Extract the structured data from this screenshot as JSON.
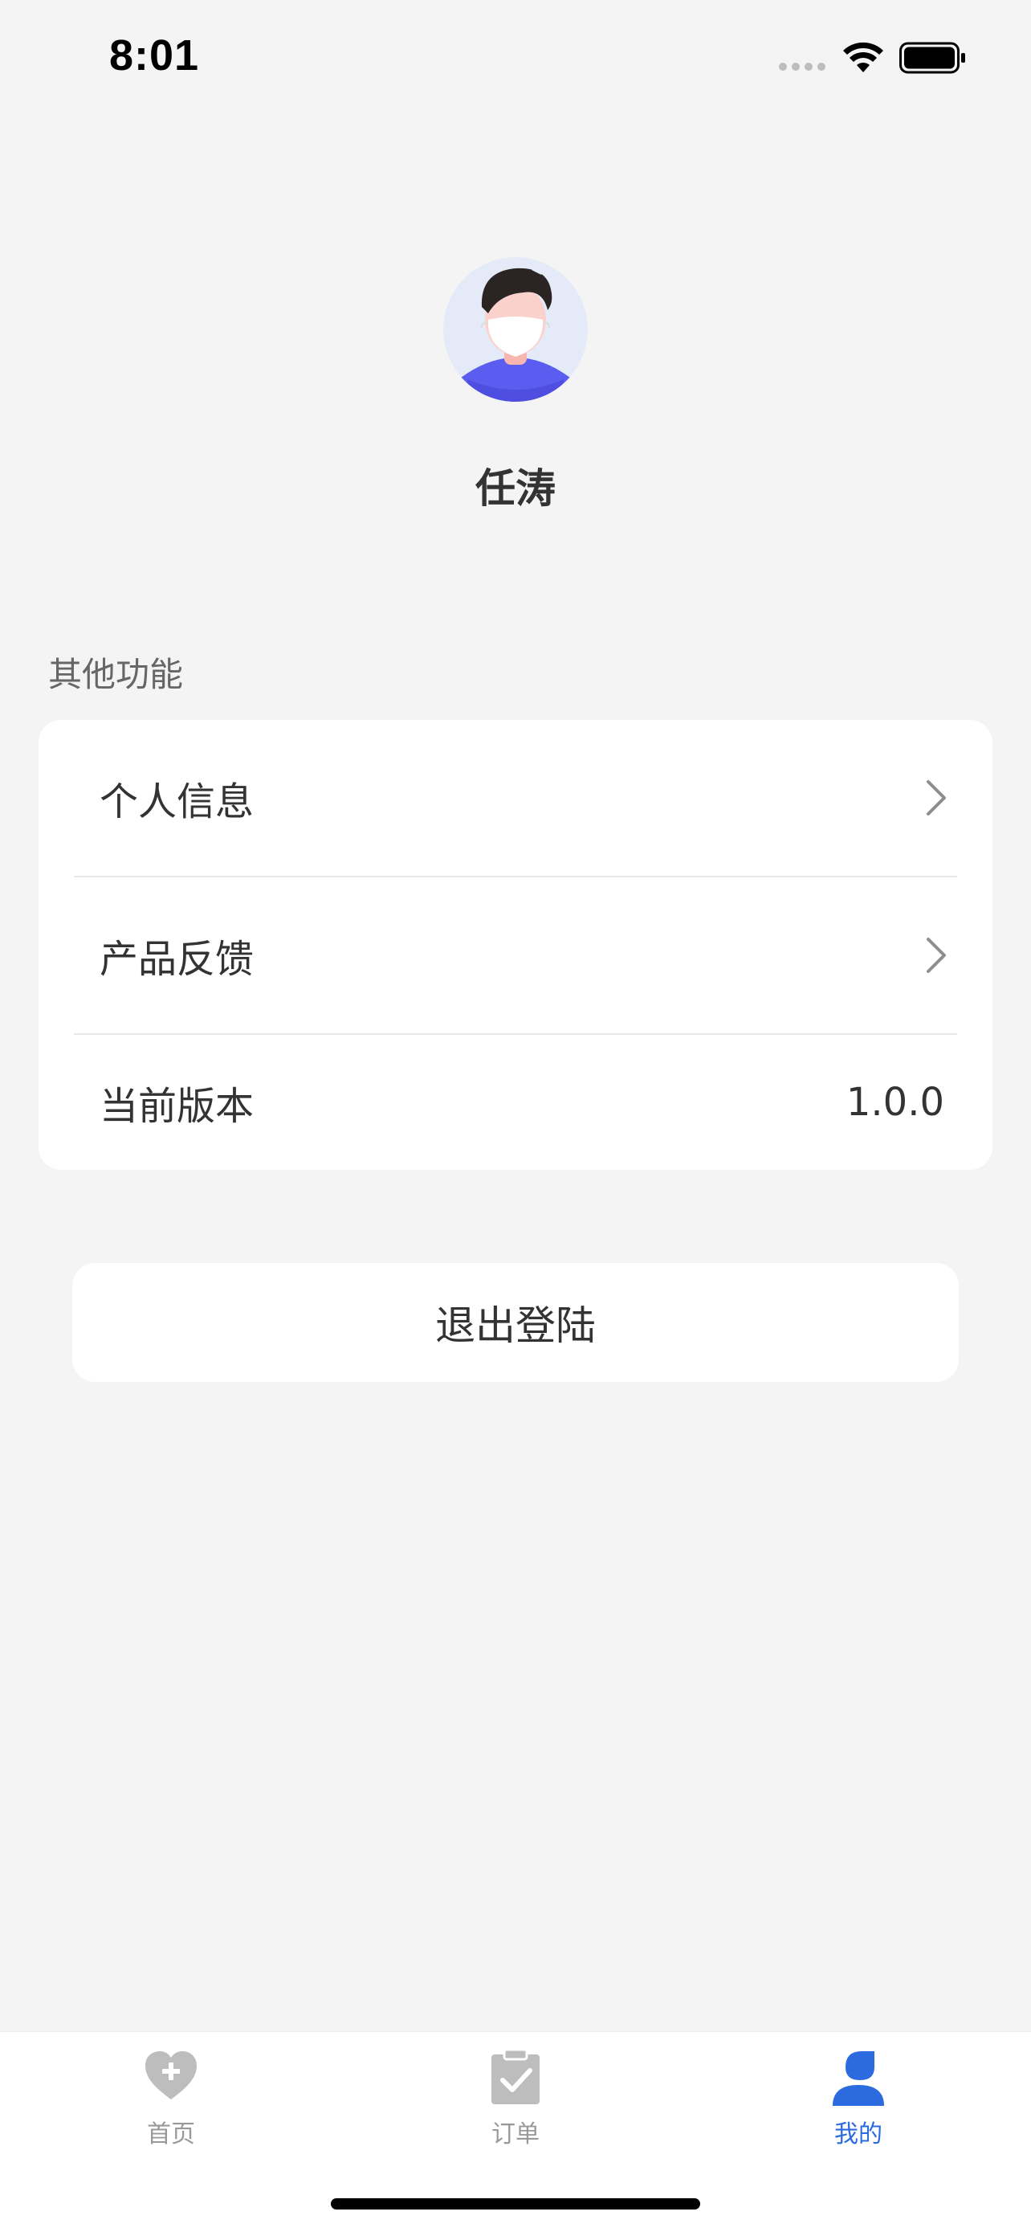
{
  "status_bar": {
    "time": "8:01"
  },
  "profile": {
    "name": "任涛",
    "avatar_icon": "person-with-mask-avatar"
  },
  "section": {
    "title": "其他功能"
  },
  "menu": {
    "items": [
      {
        "label": "个人信息",
        "icon": "chevron-right-icon"
      },
      {
        "label": "产品反馈",
        "icon": "chevron-right-icon"
      },
      {
        "label": "当前版本",
        "value": "1.0.0"
      }
    ]
  },
  "logout": {
    "label": "退出登陆"
  },
  "tab_bar": {
    "tabs": [
      {
        "label": "首页",
        "icon": "heart-plus-icon",
        "active": false
      },
      {
        "label": "订单",
        "icon": "clipboard-check-icon",
        "active": false
      },
      {
        "label": "我的",
        "icon": "person-icon",
        "active": true
      }
    ]
  },
  "colors": {
    "background": "#f4f4f4",
    "card": "#ffffff",
    "accent": "#2c6ae0",
    "inactive": "#bdbdbd",
    "text_primary": "#333333",
    "text_secondary": "#666666"
  }
}
